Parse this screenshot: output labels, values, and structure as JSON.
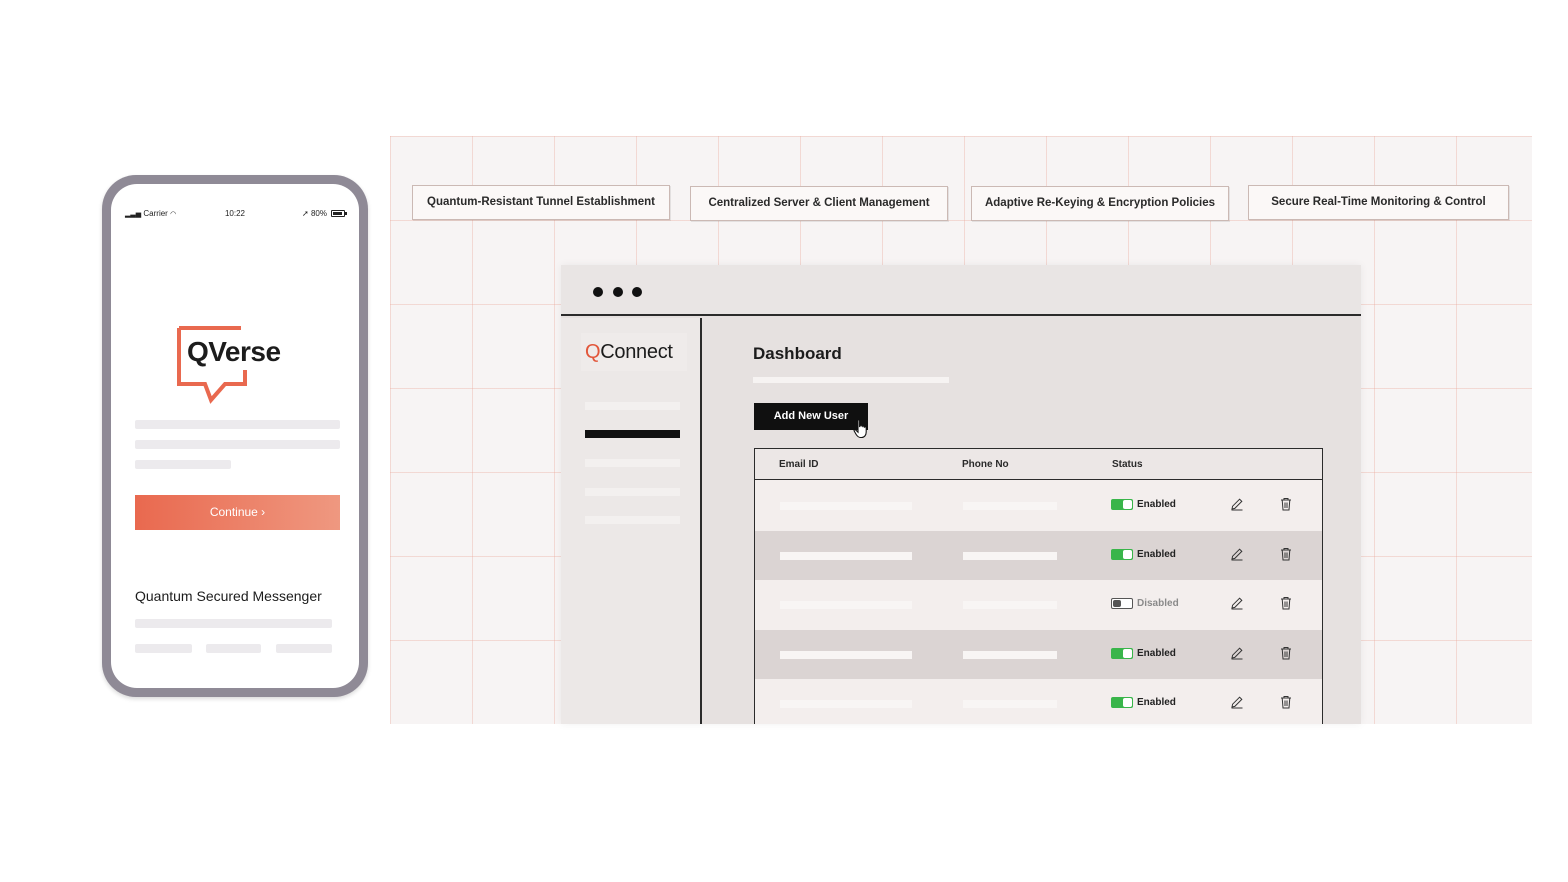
{
  "phone": {
    "status_bar": {
      "carrier": "Carrier",
      "time": "10:22",
      "battery": "80%"
    },
    "logo_text": "QVerse",
    "continue_label": "Continue ›",
    "tagline": "Quantum Secured Messenger",
    "accent_color": "#e9694f"
  },
  "features": [
    "Quantum-Resistant Tunnel Establishment",
    "Centralized Server & Client Management",
    "Adaptive Re-Keying & Encryption Policies",
    "Secure Real-Time Monitoring & Control"
  ],
  "dashboard": {
    "brand": {
      "mark": "Q",
      "rest": "Connect"
    },
    "title": "Dashboard",
    "add_user_label": "Add New User",
    "table": {
      "headers": [
        "Email ID",
        "Phone No",
        "Status"
      ],
      "rows": [
        {
          "status": "Enabled",
          "enabled": true
        },
        {
          "status": "Enabled",
          "enabled": true
        },
        {
          "status": "Disabled",
          "enabled": false
        },
        {
          "status": "Enabled",
          "enabled": true
        },
        {
          "status": "Enabled",
          "enabled": true
        }
      ]
    },
    "colors": {
      "enabled": "#39b54a",
      "brand": "#e2563a"
    },
    "icons": {
      "edit": "pencil-icon",
      "delete": "trash-icon",
      "cursor": "hand-pointer-icon"
    }
  }
}
